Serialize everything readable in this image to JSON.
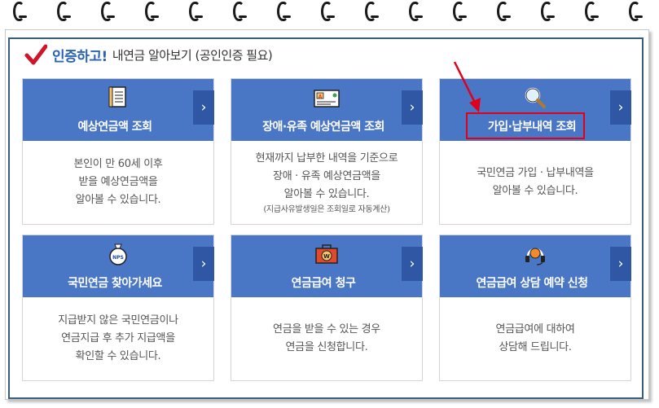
{
  "header": {
    "title": "인증하고!",
    "subtitle": "내연금 알아보기 (공인인증 필요)"
  },
  "cards": [
    {
      "title": "예상연금액 조회",
      "icon": "document-icon",
      "lines": [
        "본인이 만 60세 이후",
        "받을 예상연금액을",
        "알아볼 수 있습니다."
      ],
      "note": ""
    },
    {
      "title": "장애·유족 예상연금액 조회",
      "icon": "id-card-icon",
      "lines": [
        "현재까지 납부한 내역을 기준으로",
        "장애 · 유족 예상연금액을",
        "알아볼 수 있습니다."
      ],
      "note": "(지급사유발생일은 조회일로 자동계산)"
    },
    {
      "title": "가입·납부내역 조회",
      "icon": "magnifier-icon",
      "lines": [
        "국민연금 가입 · 납부내역을",
        "알아볼 수 있습니다."
      ],
      "note": ""
    },
    {
      "title": "국민연금 찾아가세요",
      "icon": "nps-money-bag-icon",
      "lines": [
        "지급받지 않은 국민연금이나",
        "연금지급 후 추가 지급액을",
        "확인할 수 있습니다."
      ],
      "note": ""
    },
    {
      "title": "연금급여 청구",
      "icon": "won-briefcase-icon",
      "lines": [
        "연금을 받을 수 있는 경우",
        "연금을 신청합니다."
      ],
      "note": ""
    },
    {
      "title": "연금급여 상담 예약 신청",
      "icon": "headset-icon",
      "lines": [
        "연금급여에 대하여",
        "상담해 드립니다."
      ],
      "note": ""
    }
  ],
  "colors": {
    "card_header": "#4a76c6",
    "arrow_button": "#2f57a3",
    "title_blue": "#2a62b8",
    "highlight": "#e0001b",
    "frame_border": "#3a5f7a"
  }
}
